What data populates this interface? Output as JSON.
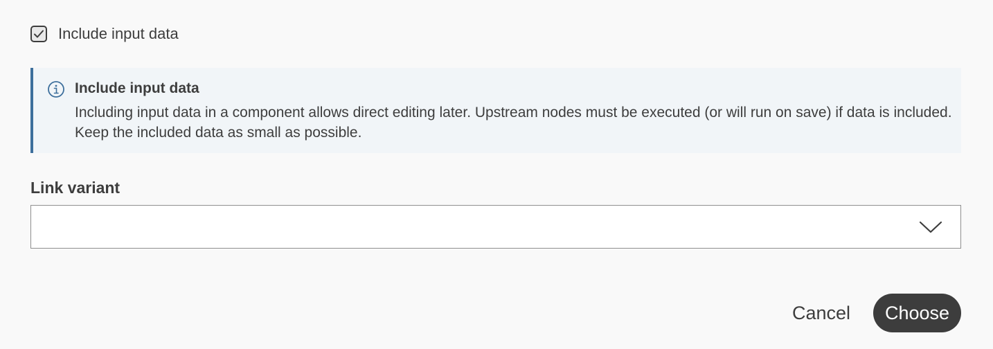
{
  "include_input": {
    "checked": true,
    "label": "Include input data"
  },
  "info_box": {
    "icon": "info-icon",
    "title": "Include input data",
    "text": "Including input data in a component allows direct editing later. Upstream nodes must be executed (or will run on save) if data is included. Keep the included data as small as possible."
  },
  "link_variant": {
    "label": "Link variant",
    "selected_value": ""
  },
  "actions": {
    "cancel_label": "Cancel",
    "choose_label": "Choose"
  },
  "colors": {
    "background": "#f9f9f9",
    "text": "#3d3d3d",
    "info_accent": "#3d6f9c",
    "info_background": "#f1f5f8",
    "primary_button": "#3d3d3d"
  }
}
